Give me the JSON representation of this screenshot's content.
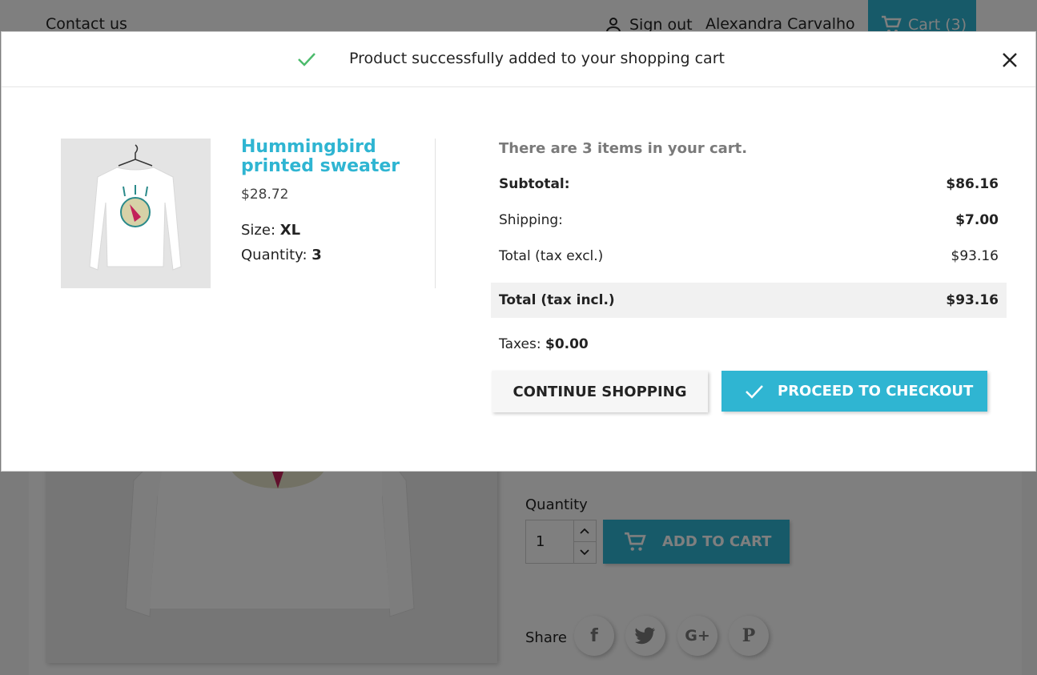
{
  "header": {
    "contact_label": "Contact us",
    "signout_label": "Sign out",
    "user_name": "Alexandra Carvalho",
    "cart_label": "Cart (3)"
  },
  "product_page": {
    "quantity_label": "Quantity",
    "quantity_value": "1",
    "add_to_cart_label": "ADD TO CART",
    "share_label": "Share",
    "share_icons": [
      "facebook-icon",
      "twitter-icon",
      "google-plus-icon",
      "pinterest-icon"
    ]
  },
  "modal": {
    "title": "Product successfully added to your shopping cart",
    "product": {
      "name": "Hummingbird printed sweater",
      "price": "$28.72",
      "size_label": "Size:",
      "size_value": "XL",
      "quantity_label": "Quantity:",
      "quantity_value": "3"
    },
    "summary": {
      "cart_count_text": "There are 3 items in your cart.",
      "subtotal_label": "Subtotal:",
      "subtotal_value": "$86.16",
      "shipping_label": "Shipping:",
      "shipping_value": "$7.00",
      "total_excl_label": "Total (tax excl.)",
      "total_excl_value": "$93.16",
      "total_incl_label": "Total (tax incl.)",
      "total_incl_value": "$93.16",
      "taxes_label": "Taxes:",
      "taxes_value": "$0.00"
    },
    "buttons": {
      "continue_label": "CONTINUE SHOPPING",
      "checkout_label": "PROCEED TO CHECKOUT"
    }
  },
  "colors": {
    "accent": "#2fb5d2",
    "success": "#4cbb6c",
    "muted": "#7a7a7a"
  }
}
